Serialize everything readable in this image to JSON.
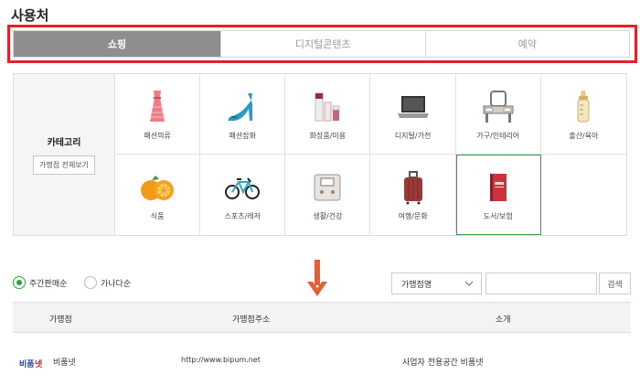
{
  "section_title": "사용처",
  "tabs": [
    {
      "label": "쇼핑",
      "active": true
    },
    {
      "label": "디지털콘텐츠",
      "active": false
    },
    {
      "label": "예약",
      "active": false
    }
  ],
  "category": {
    "title": "카테고리",
    "view_all": "가맹점 전체보기",
    "items": [
      {
        "label": "패션의류",
        "icon": "dress-icon"
      },
      {
        "label": "패션잡화",
        "icon": "high-heel-icon"
      },
      {
        "label": "화장품/미용",
        "icon": "cosmetics-icon"
      },
      {
        "label": "디지털/가전",
        "icon": "laptop-icon"
      },
      {
        "label": "가구/인테리어",
        "icon": "vanity-table-icon"
      },
      {
        "label": "출산/육아",
        "icon": "baby-bottle-icon"
      },
      {
        "label": "식품",
        "icon": "oranges-icon"
      },
      {
        "label": "스포츠/레저",
        "icon": "bicycle-icon"
      },
      {
        "label": "생활/건강",
        "icon": "scale-icon"
      },
      {
        "label": "여행/문화",
        "icon": "suitcase-icon"
      },
      {
        "label": "도서/보험",
        "icon": "book-icon",
        "selected": true
      }
    ]
  },
  "sort": {
    "weekly": "주간판매순",
    "alpha": "가나다순",
    "selected": "weekly"
  },
  "search": {
    "select_value": "가맹점명",
    "input_value": "",
    "button": "검색"
  },
  "table": {
    "headers": [
      "가맹점",
      "가맹점주소",
      "소개"
    ],
    "rows": [
      {
        "logo_text": "비품넷",
        "name": "비품넷",
        "url": "http://www.bipum.net",
        "intro": "사업자 전용공간 비품넷"
      }
    ]
  },
  "colors": {
    "highlight": "#e0232a",
    "selected_border": "#2f9e4a",
    "arrow": "#e0603a",
    "active_tab": "#8e8e8e"
  }
}
